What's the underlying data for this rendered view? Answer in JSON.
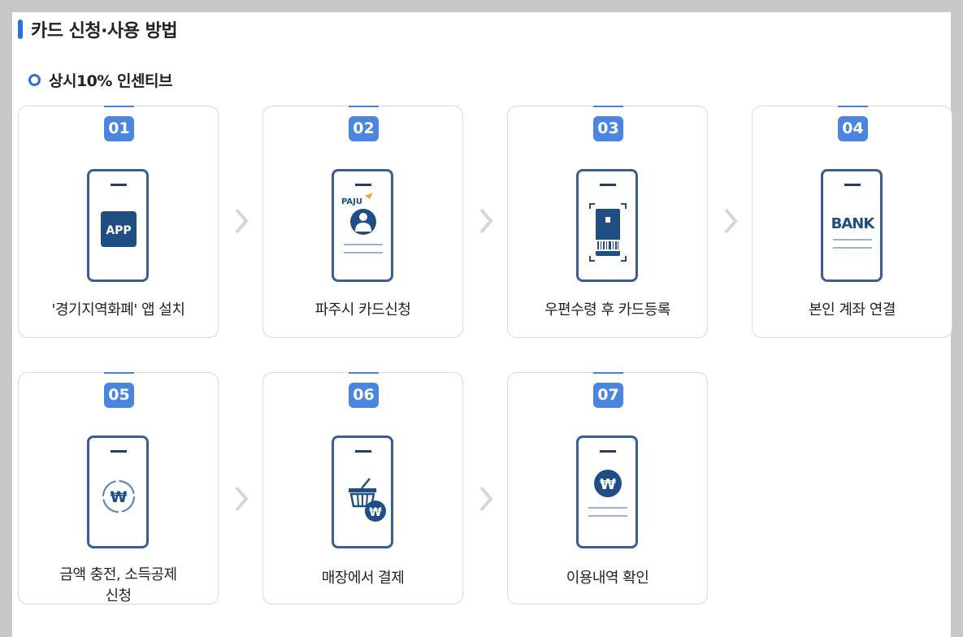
{
  "section": {
    "title": "카드 신청·사용 방법"
  },
  "subsection": {
    "title": "상시10% 인센티브"
  },
  "steps": [
    {
      "num": "01",
      "label": "'경기지역화폐' 앱 설치",
      "icon": "app-icon",
      "badge": "APP"
    },
    {
      "num": "02",
      "label": "파주시 카드신청",
      "icon": "paju-card-icon",
      "logo": "PAJU"
    },
    {
      "num": "03",
      "label": "우편수령 후 카드등록",
      "icon": "card-scan-icon"
    },
    {
      "num": "04",
      "label": "본인 계좌 연결",
      "icon": "bank-icon",
      "bank": "BANK"
    },
    {
      "num": "05",
      "label": "금액 충전, 소득공제 신청",
      "icon": "won-recharge-icon",
      "won": "₩"
    },
    {
      "num": "06",
      "label": "매장에서 결제",
      "icon": "basket-pay-icon",
      "won": "₩"
    },
    {
      "num": "07",
      "label": "이용내역 확인",
      "icon": "won-history-icon",
      "won": "₩"
    }
  ],
  "colors": {
    "accent": "#2f6fd6",
    "badge": "#4a86e0",
    "navy": "#1f4e85"
  }
}
